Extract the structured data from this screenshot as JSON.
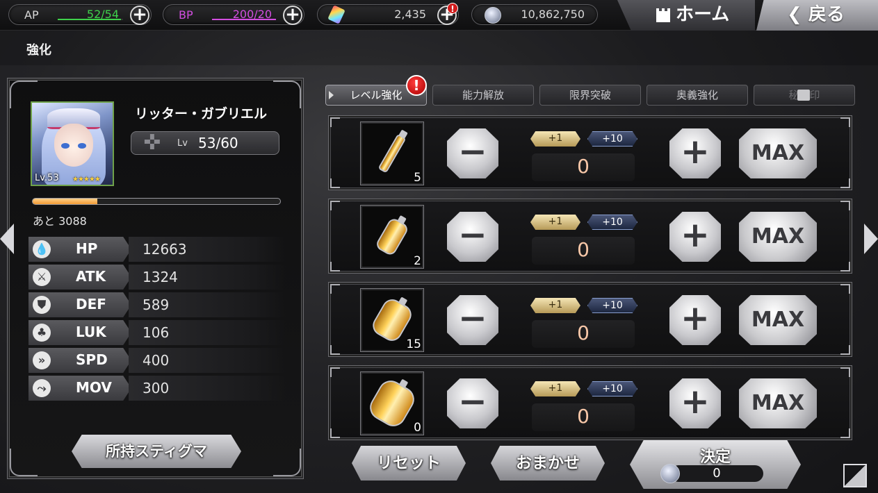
{
  "topbar": {
    "ap": {
      "label": "AP",
      "value": "52/54",
      "color": "#3fd14b",
      "fill": 0.963
    },
    "bp": {
      "label": "BP",
      "value": "200/20",
      "color": "#d24ee0",
      "fill": 1.0
    },
    "gems": {
      "icon": "rainbow-crystal-icon",
      "value": "2,435",
      "notify": "!"
    },
    "coins": {
      "icon": "silver-coin-icon",
      "value": "10,862,750"
    },
    "plus_label": "+",
    "home_label": "ホーム",
    "back_label": "戻る",
    "back_chevron": "❮"
  },
  "page_title": "強化",
  "character": {
    "name": "リッター・ガブリエル",
    "portrait_level": "Lv.53",
    "rarity_stars": "★★★★★",
    "level_prefix": "Lv",
    "level": "53/60",
    "exp_fraction": 0.26,
    "exp_rest": "あと 3088",
    "stats": [
      {
        "name": "HP",
        "value": "12663",
        "icon": "drop-icon",
        "glyph": "💧"
      },
      {
        "name": "ATK",
        "value": "1324",
        "icon": "sword-icon",
        "glyph": "⚔"
      },
      {
        "name": "DEF",
        "value": "589",
        "icon": "shield-icon",
        "glyph": "⛊"
      },
      {
        "name": "LUK",
        "value": "106",
        "icon": "clover-icon",
        "glyph": "♣"
      },
      {
        "name": "SPD",
        "value": "400",
        "icon": "speed-icon",
        "glyph": "»"
      },
      {
        "name": "MOV",
        "value": "300",
        "icon": "boot-icon",
        "glyph": "⤳"
      }
    ],
    "stigma_button": "所持スティグマ"
  },
  "tabs": [
    {
      "label": "レベル強化",
      "active": true
    },
    {
      "label": "能力解放",
      "active": false
    },
    {
      "label": "限界突破",
      "active": false
    },
    {
      "label": "奥義強化",
      "active": false
    },
    {
      "label": "秘　印",
      "active": false,
      "disabled": true
    }
  ],
  "tab_notify": "!",
  "items": [
    {
      "count": "5",
      "qty": "0",
      "size": "small"
    },
    {
      "count": "2",
      "qty": "0",
      "size": "medium"
    },
    {
      "count": "15",
      "qty": "0",
      "size": "large"
    },
    {
      "count": "0",
      "qty": "0",
      "size": "xlarge"
    }
  ],
  "controls": {
    "minus": "−",
    "plus": "+",
    "plus_one": "+1",
    "plus_ten": "+10",
    "max": "MAX"
  },
  "bottom": {
    "reset": "リセット",
    "auto": "おまかせ",
    "confirm": "決定",
    "cost": "0"
  }
}
